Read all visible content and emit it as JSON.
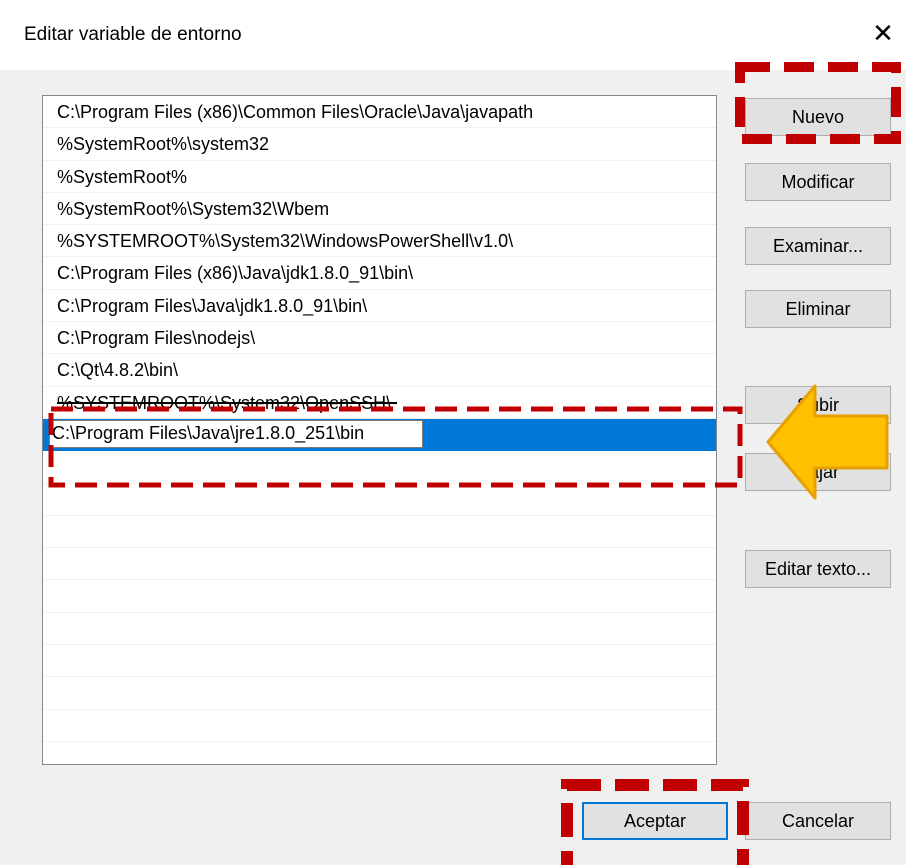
{
  "dialog": {
    "title": "Editar variable de entorno",
    "close_glyph": "✕"
  },
  "paths": [
    "C:\\Program Files (x86)\\Common Files\\Oracle\\Java\\javapath",
    "%SystemRoot%\\system32",
    "%SystemRoot%",
    "%SystemRoot%\\System32\\Wbem",
    "%SYSTEMROOT%\\System32\\WindowsPowerShell\\v1.0\\",
    "C:\\Program Files (x86)\\Java\\jdk1.8.0_91\\bin\\",
    "C:\\Program Files\\Java\\jdk1.8.0_91\\bin\\",
    "C:\\Program Files\\nodejs\\",
    "C:\\Qt\\4.8.2\\bin\\",
    "%SYSTEMROOT%\\System32\\OpenSSH\\"
  ],
  "editing_value": "C:\\Program Files\\Java\\jre1.8.0_251\\bin",
  "buttons": {
    "new": "Nuevo",
    "edit": "Modificar",
    "browse": "Examinar...",
    "delete": "Eliminar",
    "up": "Subir",
    "down": "Bajar",
    "edit_text": "Editar texto...",
    "ok": "Aceptar",
    "cancel": "Cancelar"
  },
  "colors": {
    "selection": "#0078d7",
    "annotation_dash": "#c00000",
    "arrow_fill": "#ffc000",
    "arrow_stroke": "#e6a000"
  }
}
